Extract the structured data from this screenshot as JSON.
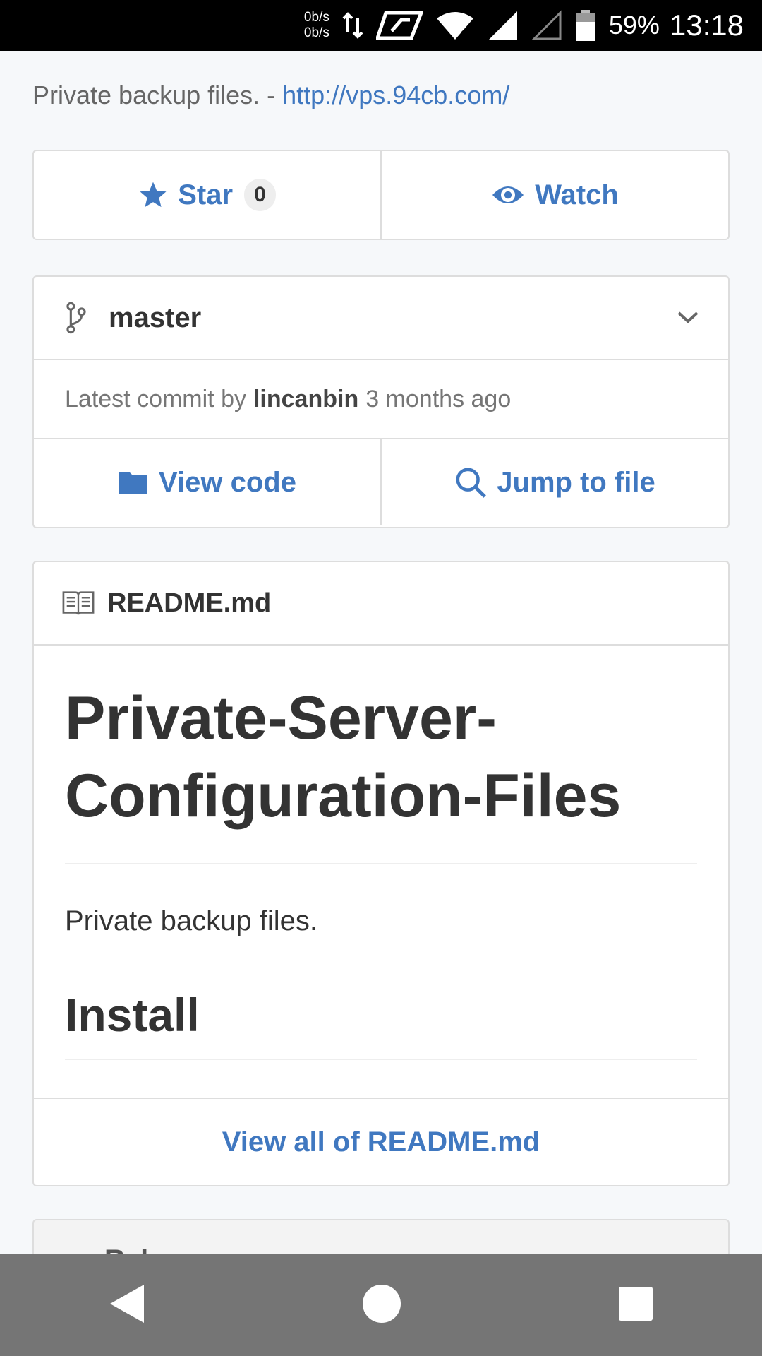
{
  "status_bar": {
    "net_up": "0b/s",
    "net_down": "0b/s",
    "battery_pct": "59%",
    "time": "13:18",
    "icons": [
      "data-arrows-icon",
      "notification-icon",
      "wifi-icon",
      "signal-icon",
      "signal-empty-icon",
      "battery-icon"
    ]
  },
  "repo": {
    "description": "Private backup files. - ",
    "link": "http://vps.94cb.com/",
    "star_label": "Star",
    "star_count": "0",
    "watch_label": "Watch"
  },
  "branch": {
    "name": "master",
    "commit_prefix": "Latest commit by",
    "commit_author": "lincanbin",
    "commit_time": "3 months ago",
    "view_code_label": "View code",
    "jump_label": "Jump to file"
  },
  "readme": {
    "filename": "README.md",
    "title": "Private-Server-Configuration-Files",
    "paragraph": "Private backup files.",
    "section": "Install",
    "view_all": "View all of README.md"
  },
  "next_section": {
    "peek": "Rel"
  },
  "colors": {
    "link": "#4078c0",
    "border": "#dddddd",
    "nav_bar": "#757575"
  }
}
